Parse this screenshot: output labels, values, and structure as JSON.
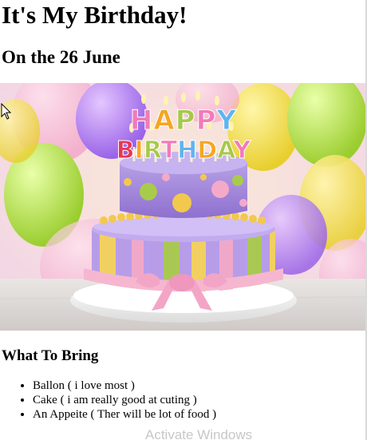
{
  "page": {
    "title": "It's My Birthday!",
    "subtitle": "On the 26 June",
    "section_heading": "What To Bring",
    "items": [
      "Ballon ( i love most )",
      "Cake ( i am really good at cuting )",
      "An Appeite ( Ther will be lot of food )"
    ]
  },
  "image": {
    "candle_text_1": "HAPPY",
    "candle_text_2": "BIRTHDAY",
    "colors": {
      "cake_purple": "#a78ad6",
      "cake_pink": "#f3a9c7",
      "cake_yellow": "#f2cc4a",
      "cake_green": "#a6c94a"
    }
  },
  "os_overlay": {
    "watermark": "Activate Windows"
  },
  "icons": {
    "cursor": "mouse-cursor-icon"
  }
}
